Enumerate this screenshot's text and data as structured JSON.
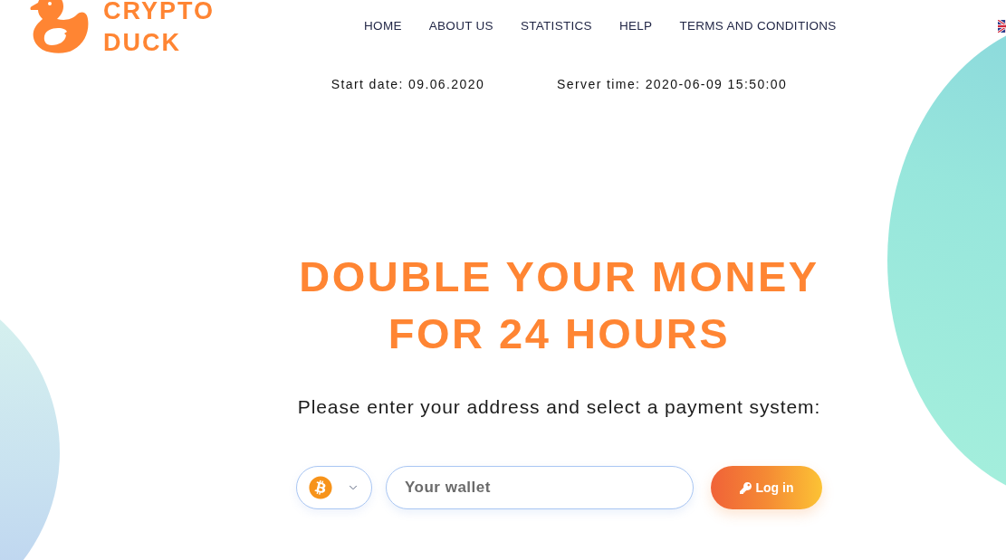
{
  "logo": {
    "lines": [
      "CRYPTO",
      "DUCK"
    ]
  },
  "nav": [
    {
      "label": "HOME"
    },
    {
      "label": "ABOUT US"
    },
    {
      "label": "STATISTICS"
    },
    {
      "label": "HELP"
    },
    {
      "label": "TERMS AND CONDITIONS"
    }
  ],
  "info": [
    "Start date: 09.06.2020",
    "Server time: 2020-06-09 15:50:00"
  ],
  "hero": {
    "title_lines": [
      "DOUBLE YOUR MONEY",
      "FOR 24 HOURS"
    ],
    "subtitle": "Please enter your address and select a payment system:"
  },
  "form": {
    "wallet": {
      "placeholder": "Your wallet"
    },
    "button": {
      "label": "Log in"
    }
  }
}
